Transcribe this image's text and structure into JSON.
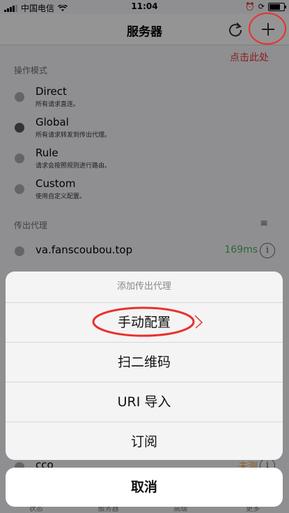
{
  "status_bar": {
    "carrier": "中国电信",
    "time": "11:04"
  },
  "nav": {
    "title": "服务器",
    "refresh_icon": "refresh-icon",
    "add_icon": "plus-icon"
  },
  "annotation": {
    "text": "点击此处",
    "color": "#e8312f"
  },
  "mode_section": {
    "label": "操作模式",
    "modes": [
      {
        "name": "Direct",
        "desc": "所有请求直连。",
        "selected": false
      },
      {
        "name": "Global",
        "desc": "所有请求转发到传出代理。",
        "selected": true
      },
      {
        "name": "Rule",
        "desc": "请求会按照规则进行路由。",
        "selected": false
      },
      {
        "name": "Custom",
        "desc": "使用自定义配置。",
        "selected": false
      }
    ]
  },
  "proxy_section": {
    "label": "传出代理",
    "menu_icon": "list-icon",
    "proxies": [
      {
        "name": "va.fanscoubou.top",
        "latency": "169ms"
      },
      {
        "name": "cco",
        "latency": "未测"
      }
    ]
  },
  "tabs": [
    "状态",
    "服务器",
    "高级",
    "更多"
  ],
  "sheet": {
    "title": "添加传出代理",
    "options": [
      "手动配置",
      "扫二维码",
      "URI 导入",
      "订阅"
    ],
    "cancel": "取消"
  },
  "colors": {
    "latency_ok": "#4caf50",
    "latency_untested": "#f0a030",
    "annotation_red": "#e8312f"
  }
}
